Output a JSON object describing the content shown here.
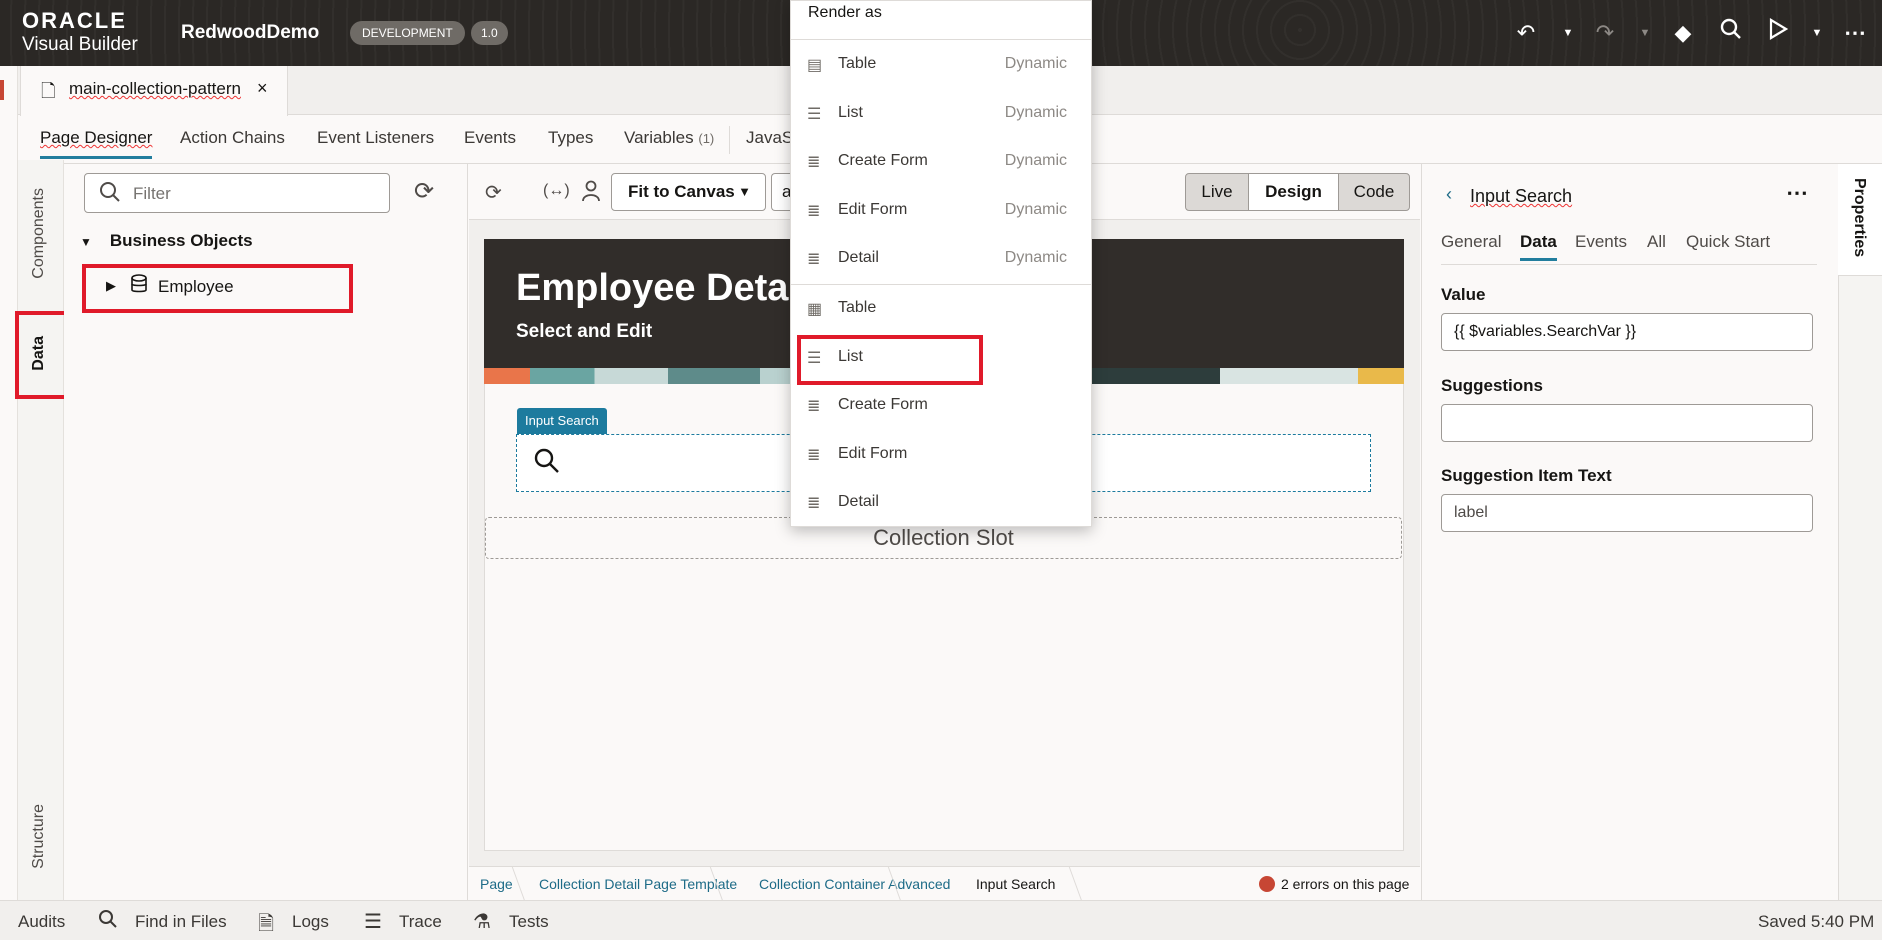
{
  "header": {
    "logo_line1": "ORACLE",
    "logo_line2": "Visual Builder",
    "app_name": "RedwoodDemo",
    "env_badge": "DEVELOPMENT",
    "version_badge": "1.0"
  },
  "file_tab": {
    "name": "main-collection-pattern",
    "close": "×"
  },
  "nav_tabs": {
    "page_designer": "Page Designer",
    "action_chains": "Action Chains",
    "event_listeners": "Event Listeners",
    "events": "Events",
    "types": "Types",
    "variables": "Variables",
    "variables_count": "(1)",
    "javascript": "JavaS"
  },
  "side_tabs": {
    "components": "Components",
    "data": "Data",
    "structure": "Structure"
  },
  "data_panel": {
    "filter_placeholder": "Filter",
    "group": "Business Objects",
    "item": "Employee"
  },
  "canvas_toolbar": {
    "fit": "Fit to Canvas",
    "small_select": "a",
    "modes": [
      "Live",
      "Design",
      "Code"
    ]
  },
  "canvas": {
    "banner_title": "Employee Detail",
    "banner_subtitle": "Select and Edit",
    "input_search_label": "Input Search",
    "collection_slot": "Collection Slot"
  },
  "breadcrumb": {
    "items": [
      "Page",
      "Collection Detail Page Template",
      "Collection Container Advanced",
      "Input Search"
    ],
    "errors": "2 errors on this page"
  },
  "properties": {
    "edge_label": "Properties",
    "title": "Input Search",
    "tabs": [
      "General",
      "Data",
      "Events",
      "All",
      "Quick Start"
    ],
    "value_label": "Value",
    "value": "{{ $variables.SearchVar }}",
    "suggestions_label": "Suggestions",
    "suggestions_value": "",
    "suggestion_item_text_label": "Suggestion Item Text",
    "suggestion_item_text_value": "label"
  },
  "bottom_bar": {
    "audits": "Audits",
    "find": "Find in Files",
    "logs": "Logs",
    "trace": "Trace",
    "tests": "Tests",
    "saved": "Saved 5:40 PM"
  },
  "render_menu": {
    "header": "Render as",
    "dynamic": [
      {
        "label": "Table",
        "tag": "Dynamic"
      },
      {
        "label": "List",
        "tag": "Dynamic"
      },
      {
        "label": "Create Form",
        "tag": "Dynamic"
      },
      {
        "label": "Edit Form",
        "tag": "Dynamic"
      },
      {
        "label": "Detail",
        "tag": "Dynamic"
      }
    ],
    "static": [
      "Table",
      "List",
      "Create Form",
      "Edit Form",
      "Detail"
    ]
  },
  "colors": {
    "accent": "#227e9e",
    "highlight": "#e01a2a",
    "header_bg": "#2b2825"
  }
}
